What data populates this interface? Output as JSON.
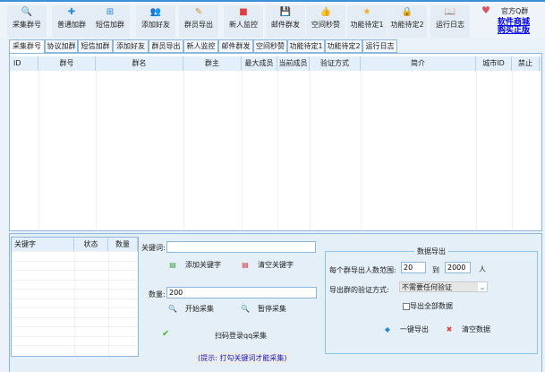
{
  "toolbar": {
    "buttons": [
      {
        "label": "采集群号",
        "icon": "magnifier-icon",
        "glyph": "🔍",
        "color": "#2a7fd0"
      },
      {
        "label": "普通加群",
        "icon": "plus-icon",
        "glyph": "✚",
        "color": "#2a8ae0"
      },
      {
        "label": "短信加群",
        "icon": "plus-box-icon",
        "glyph": "⊞",
        "color": "#2a8ae0"
      },
      {
        "label": "添加好友",
        "icon": "add-user-icon",
        "glyph": "👥",
        "color": "#d0a030"
      },
      {
        "label": "群员导出",
        "icon": "pencil-icon",
        "glyph": "✎",
        "color": "#d09030"
      },
      {
        "label": "新人监控",
        "icon": "stop-icon",
        "glyph": "■",
        "color": "#e04040"
      },
      {
        "label": "邮件群发",
        "icon": "floppy-icon",
        "glyph": "💾",
        "color": "#3a8ad8"
      },
      {
        "label": "空间秒赞",
        "icon": "thumbs-up-icon",
        "glyph": "👍",
        "color": "#e0a040"
      },
      {
        "label": "功能待定1",
        "icon": "star-icon",
        "glyph": "★",
        "color": "#f0b020"
      },
      {
        "label": "功能待定2",
        "icon": "lock-icon",
        "glyph": "🔒",
        "color": "#e0b030"
      },
      {
        "label": "运行日志",
        "icon": "book-icon",
        "glyph": "📖",
        "color": "#e0a040"
      }
    ],
    "qq_group": "官方Q群",
    "shop_line1": "软件商城",
    "shop_line2": "购买正版",
    "heart_color": "#e05060",
    "link_color": "#0000ee"
  },
  "tabs": [
    "采集群号",
    "协议加群",
    "短信加群",
    "添加好友",
    "群员导出",
    "新人监控",
    "邮件群发",
    "空间秒赞",
    "功能待定1",
    "功能待定2",
    "运行日志"
  ],
  "grid": {
    "columns": [
      "ID",
      "群号",
      "群名",
      "群主",
      "最大成员",
      "当前成员",
      "验证方式",
      "简介",
      "城市ID",
      "禁止"
    ]
  },
  "keywords": {
    "columns": [
      "关键字",
      "状态",
      "数量"
    ]
  },
  "collect": {
    "keyword_label": "关键词:",
    "keyword_value": "",
    "add_keyword": "添加关键字",
    "clear_keyword": "清空关键字",
    "count_label": "数量:",
    "count_value": "200",
    "start": "开始采集",
    "pause": "暂停采集",
    "qr_login": "扫码登录qq采集",
    "hint": "(提示: 打勾关键词才能采集)",
    "hint_color": "#2020c0"
  },
  "export": {
    "title": "数据导出",
    "range_label": "每个群导出人数范围:",
    "range_from": "20",
    "range_to_label": "到",
    "range_to": "2000",
    "unit": "人",
    "verify_label": "导出群的验证方式:",
    "verify_value": "不需要任何验证",
    "export_all": "导出全部数据",
    "export_all_checked": false,
    "one_click": "一键导出",
    "clear_data": "清空数据"
  }
}
